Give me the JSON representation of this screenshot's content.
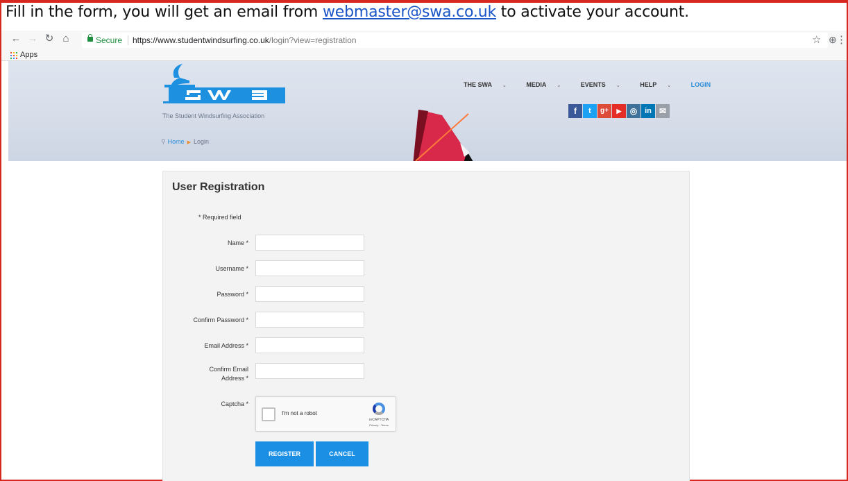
{
  "caption": {
    "prefix": "Fill in the form, you will get an email from ",
    "email": "webmaster@swa.co.uk",
    "suffix": " to activate your account."
  },
  "browser": {
    "secure_label": "Secure",
    "url_prefix": "https://",
    "url_host": "www.studentwindsurfing.co.uk",
    "url_path": "/login?view=registration",
    "bookmarks": [
      {
        "label": "Apps",
        "icon": "apps-grid-icon"
      }
    ]
  },
  "site": {
    "tagline": "The Student Windsurfing Association",
    "nav": [
      {
        "label": "THE SWA",
        "dropdown": true
      },
      {
        "label": "MEDIA",
        "dropdown": true
      },
      {
        "label": "EVENTS",
        "dropdown": true
      },
      {
        "label": "HELP",
        "dropdown": true
      },
      {
        "label": "LOGIN",
        "dropdown": false
      }
    ],
    "social": [
      {
        "icon": "facebook-icon",
        "glyph": "f",
        "color": "#3b5998"
      },
      {
        "icon": "twitter-icon",
        "glyph": "t",
        "color": "#1da1f2"
      },
      {
        "icon": "google-plus-icon",
        "glyph": "g+",
        "color": "#dd4b39"
      },
      {
        "icon": "youtube-icon",
        "glyph": "▶",
        "color": "#e52d27"
      },
      {
        "icon": "instagram-icon",
        "glyph": "◎",
        "color": "#3f729b"
      },
      {
        "icon": "linkedin-icon",
        "glyph": "in",
        "color": "#0077b5"
      },
      {
        "icon": "email-icon",
        "glyph": "✉",
        "color": "#9aa0a8"
      }
    ],
    "breadcrumb": {
      "home": "Home",
      "current": "Login"
    }
  },
  "form": {
    "title": "User Registration",
    "required_note": "* Required field",
    "fields": [
      {
        "label": "Name *",
        "value": ""
      },
      {
        "label": "Username *",
        "value": ""
      },
      {
        "label": "Password *",
        "value": ""
      },
      {
        "label": "Confirm Password *",
        "value": ""
      },
      {
        "label": "Email Address *",
        "value": ""
      },
      {
        "label": "Confirm Email Address *",
        "value": ""
      }
    ],
    "captcha": {
      "label": "Captcha *",
      "checkbox_label": "I'm not a robot",
      "brand": "reCAPTCHA",
      "terms": "Privacy - Terms"
    },
    "register_label": "REGISTER",
    "cancel_label": "CANCEL"
  },
  "colors": {
    "frame": "#d6281f",
    "accent": "#1a8fe3",
    "link": "#2a8bd6"
  }
}
